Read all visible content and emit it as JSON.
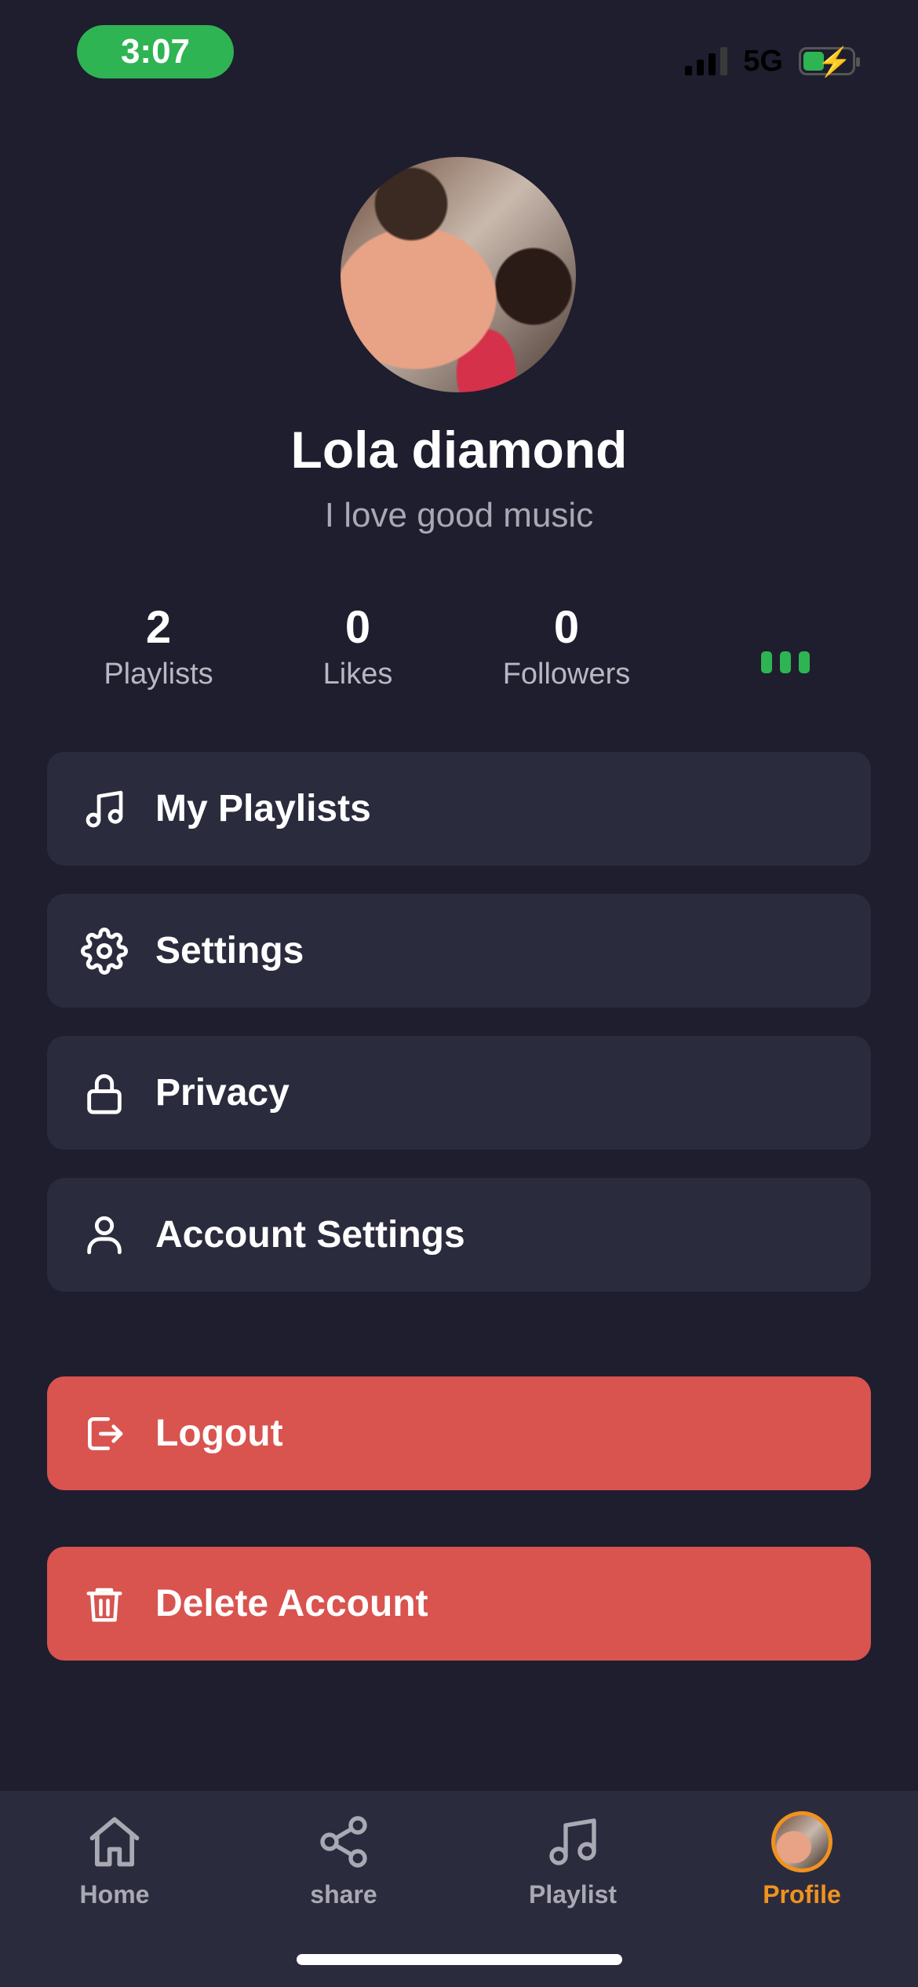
{
  "status_bar": {
    "time": "3:07",
    "network": "5G"
  },
  "profile": {
    "name": "Lola diamond",
    "bio": "I love good music"
  },
  "stats": [
    {
      "value": "2",
      "label": "Playlists"
    },
    {
      "value": "0",
      "label": "Likes"
    },
    {
      "value": "0",
      "label": "Followers"
    }
  ],
  "menu": {
    "my_playlists": "My Playlists",
    "settings": "Settings",
    "privacy": "Privacy",
    "account_settings": "Account Settings"
  },
  "actions": {
    "logout": "Logout",
    "delete_account": "Delete Account"
  },
  "tabs": [
    {
      "label": "Home",
      "icon": "home-icon"
    },
    {
      "label": "share",
      "icon": "share-icon"
    },
    {
      "label": "Playlist",
      "icon": "music-note-icon"
    },
    {
      "label": "Profile",
      "icon": "avatar",
      "active": true
    }
  ],
  "colors": {
    "background": "#1e1e2f",
    "card": "#2b2b3e",
    "accent_green": "#2fb453",
    "danger": "#d9534f",
    "active_tab": "#f0921e"
  }
}
